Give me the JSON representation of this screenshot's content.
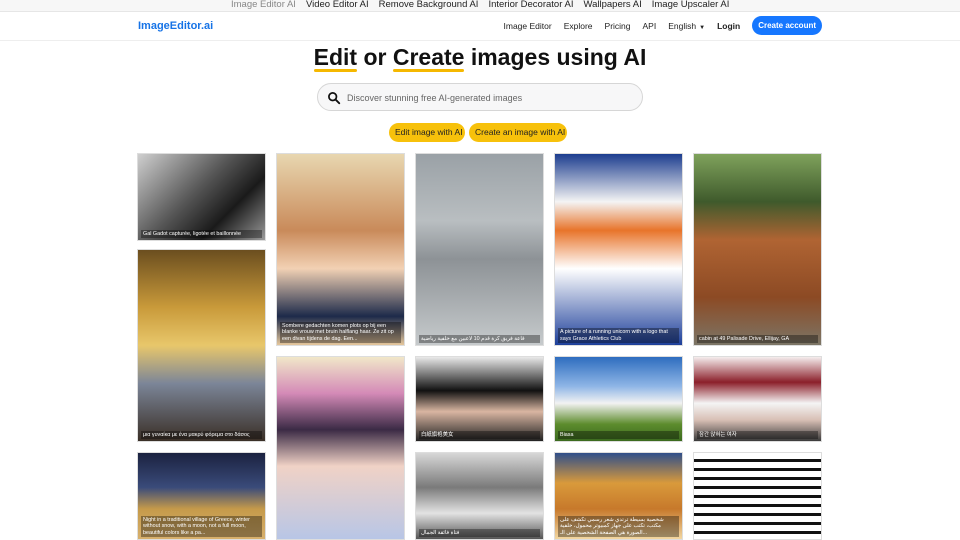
{
  "top_links": [
    {
      "label": "Image Editor AI",
      "muted": true
    },
    {
      "label": "Video Editor AI",
      "muted": false
    },
    {
      "label": "Remove Background AI",
      "muted": false
    },
    {
      "label": "Interior Decorator AI",
      "muted": false
    },
    {
      "label": "Wallpapers AI",
      "muted": false
    },
    {
      "label": "Image Upscaler AI",
      "muted": false
    }
  ],
  "brand": "ImageEditor.ai",
  "nav": {
    "image_editor": "Image Editor",
    "explore": "Explore",
    "pricing": "Pricing",
    "api": "API",
    "language": "English",
    "login": "Login",
    "create_account": "Create account"
  },
  "hero": {
    "word1": "Edit",
    "word2": "or",
    "word3": "Create",
    "rest": "images using AI"
  },
  "search": {
    "placeholder": "Discover stunning free AI-generated images",
    "icon": "search-icon"
  },
  "cta": {
    "edit": "Edit image with AI",
    "create": "Create an image with AI"
  },
  "gallery": [
    {
      "caption": "Gal Gadot capturée, ligotée et baillonnée"
    },
    {
      "caption": "Sombere gedachten komen plots op bij een blanke vrouw met bruin halflang haar. Ze zit op een divan tijdens de dag. Een..."
    },
    {
      "caption": "قاعة فريق كرة قدم 10 لاعبين مع خلفية رياضية"
    },
    {
      "caption": "A picture of a running unicorn with a logo that says Grace Athletics Club"
    },
    {
      "caption": "cabin at 49 Palisade Drive, Ellijay, GA"
    },
    {
      "caption": "μια γυναίκα με ένα μακρύ φόρεμα στο δάσος"
    },
    {
      "caption": ""
    },
    {
      "caption": "白紙旗袍美女"
    },
    {
      "caption": "Biasa"
    },
    {
      "caption": "잠간 앉혀는 여자"
    },
    {
      "caption": "Night in a traditional village of Greece, winter without snow, with a moon, not a full moon, beautiful colors like a pa..."
    },
    {
      "caption": "فتاة فائقة الجمال"
    },
    {
      "caption": "شخصية بسيطة ترتدي شعر رسمي تكشف على مكتب، تكتب على جهاز كمبيوتر محمول، خلفية الصورة هي الصفحة الشخصية على الـ..."
    },
    {
      "caption": ""
    }
  ]
}
